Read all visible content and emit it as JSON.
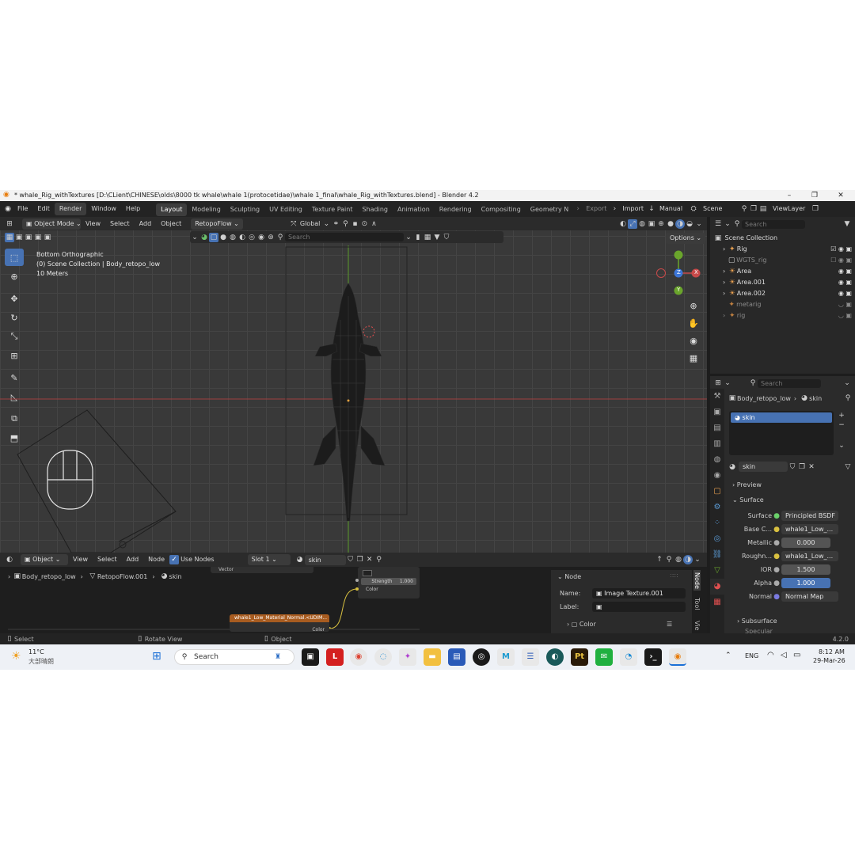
{
  "window": {
    "title": "* whale_Rig_withTextures [D:\\CLient\\CHINESE\\olds\\8000 tk whale\\whale 1(protocetidae)\\whale 1_final\\whale_Rig_withTextures.blend] - Blender 4.2",
    "minimize": "–",
    "maximize": "❐",
    "close": "✕"
  },
  "menubar": {
    "items": [
      "File",
      "Edit",
      "Render",
      "Window",
      "Help"
    ],
    "workspaces": [
      "Layout",
      "Modeling",
      "Sculpting",
      "UV Editing",
      "Texture Paint",
      "Shading",
      "Animation",
      "Rendering",
      "Compositing",
      "Geometry N"
    ],
    "export": "Export",
    "import": "Import",
    "manual": "Manual",
    "scene": "Scene",
    "view_layer": "ViewLayer"
  },
  "viewport": {
    "mode": "Object Mode",
    "menus": [
      "View",
      "Select",
      "Add",
      "Object"
    ],
    "addon": "RetopoFlow",
    "transform": "Global",
    "search_placeholder": "Search",
    "options": "Options",
    "overlay": {
      "view": "Bottom Orthographic",
      "collection": "(0) Scene Collection | Body_retopo_low",
      "scale": "10 Meters"
    },
    "gizmo": {
      "x": "X",
      "y": "Y",
      "z": "Z"
    }
  },
  "outliner": {
    "search_placeholder": "Search",
    "root": "Scene Collection",
    "rows": [
      {
        "name": "Rig",
        "dim": false
      },
      {
        "name": "WGTS_rig",
        "dim": true
      },
      {
        "name": "Area",
        "dim": false
      },
      {
        "name": "Area.001",
        "dim": false
      },
      {
        "name": "Area.002",
        "dim": false
      },
      {
        "name": "metarig",
        "dim": true
      },
      {
        "name": "rig",
        "dim": true
      }
    ]
  },
  "properties": {
    "search_placeholder": "Search",
    "object": "Body_retopo_low",
    "material": "skin",
    "slot_name": "skin",
    "material_field": "skin",
    "preview": "Preview",
    "surface_panel": "Surface",
    "rows": [
      {
        "label": "Surface",
        "value": "Principled BSDF",
        "style": "dark"
      },
      {
        "label": "Base C...",
        "value": "whale1_Low_...",
        "style": "dark"
      },
      {
        "label": "Metallic",
        "value": "0.000",
        "style": "grey"
      },
      {
        "label": "Roughn...",
        "value": "whale1_Low_...",
        "style": "dark"
      },
      {
        "label": "IOR",
        "value": "1.500",
        "style": "grey"
      },
      {
        "label": "Alpha",
        "value": "1.000",
        "style": "blue"
      },
      {
        "label": "Normal",
        "value": "Normal Map",
        "style": "dark"
      }
    ],
    "subsurface": "Subsurface",
    "specular": "Specular"
  },
  "node_editor": {
    "type": "Object",
    "menus": [
      "View",
      "Select",
      "Add",
      "Node"
    ],
    "use_nodes": "Use Nodes",
    "slot": "Slot 1",
    "material": "skin",
    "breadcrumb": [
      "Body_retopo_low",
      "RetopoFlow.001",
      "skin"
    ],
    "node_vector": "Vector",
    "node_strength_label": "Strength",
    "node_strength": "1.000",
    "node_color": "Color",
    "tex_node_title": "whale1_Low_Material_Normal.<UDIM...",
    "tex_node_color": "Color",
    "side_panel": {
      "header": "Node",
      "name_label": "Name:",
      "name_value": "Image Texture.001",
      "label_label": "Label:",
      "color_label": "Color",
      "tabs": [
        "Node",
        "Tool",
        "Vie"
      ]
    }
  },
  "statusbar": {
    "select": "Select",
    "rotate": "Rotate View",
    "object": "Object",
    "version": "4.2.0"
  },
  "taskbar": {
    "temp": "11°C",
    "weather": "大部晴朗",
    "search": "Search",
    "lang": "ENG",
    "time": "8:12 AM",
    "date": "29-Mar-26"
  },
  "colors": {
    "accent": "#4772b3",
    "x_axis": "#c84a4a",
    "y_axis": "#6aa52c",
    "z_axis": "#3c76d8"
  }
}
